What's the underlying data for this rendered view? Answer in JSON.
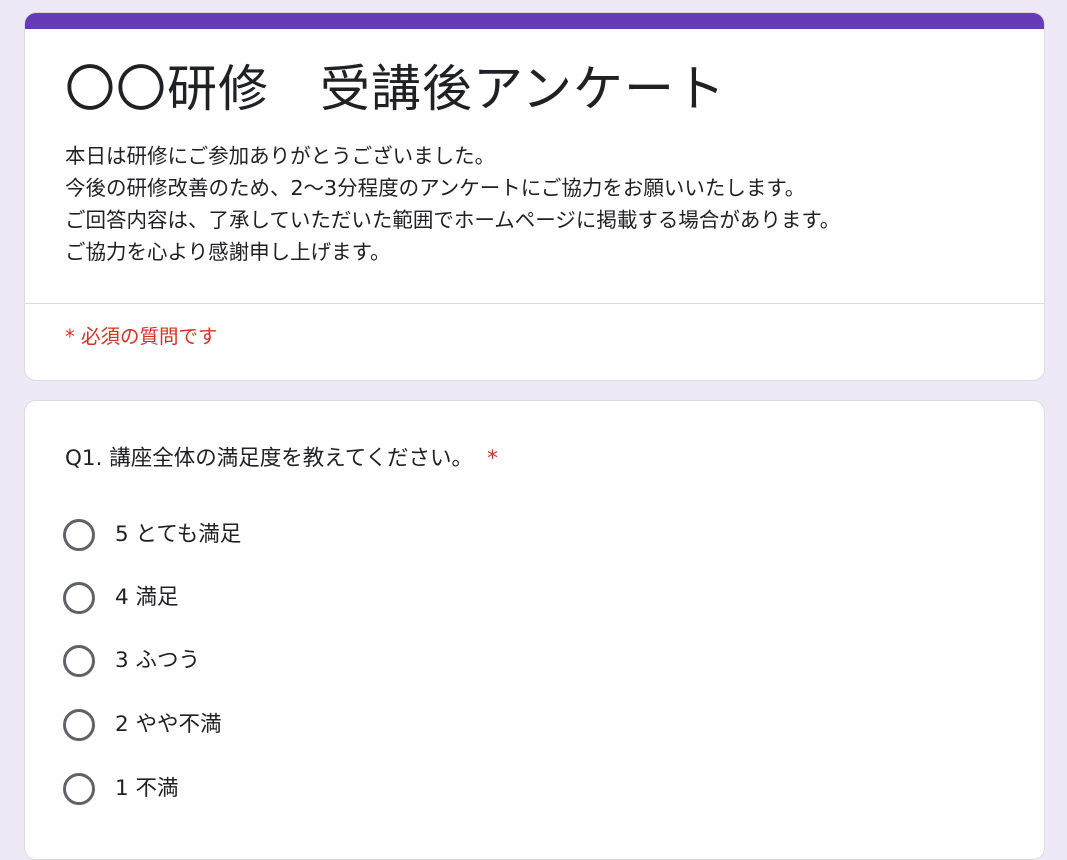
{
  "form": {
    "accent_color": "#673ab7",
    "title": "〇〇研修　受講後アンケート",
    "description": [
      "本日は研修にご参加ありがとうございました。",
      "今後の研修改善のため、2〜3分程度のアンケートにご協力をお願いいたします。",
      "ご回答内容は、了承していただいた範囲でホームページに掲載する場合があります。",
      "ご協力を心より感謝申し上げます。"
    ],
    "required_note": "* 必須の質問です",
    "required_color": "#d93025"
  },
  "question": {
    "title": "Q1. 講座全体の満足度を教えてください。",
    "required_mark": "*",
    "options": [
      {
        "label": "5 とても満足",
        "selected": false
      },
      {
        "label": "4 満足",
        "selected": false
      },
      {
        "label": "3 ふつう",
        "selected": false
      },
      {
        "label": "2 やや不満",
        "selected": false
      },
      {
        "label": "1 不満",
        "selected": false
      }
    ]
  }
}
